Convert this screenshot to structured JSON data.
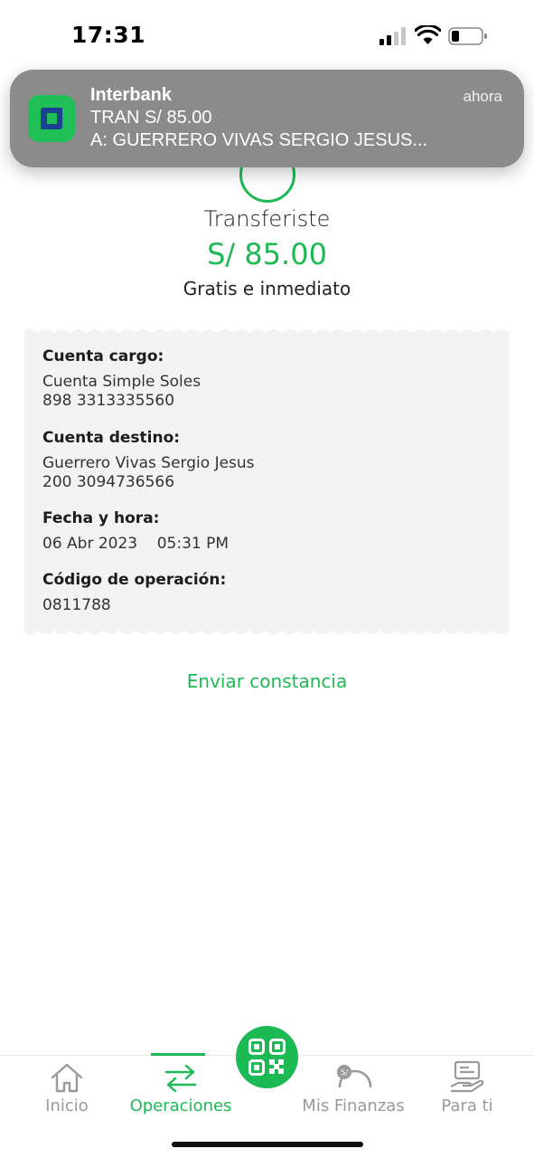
{
  "status_bar": {
    "time": "17:31"
  },
  "notification": {
    "app_name": "Interbank",
    "time": "ahora",
    "line1": "TRAN S/ 85.00",
    "line2": "A: GUERRERO VIVAS SERGIO JESUS..."
  },
  "header": {
    "title": "Transferiste",
    "amount": "S/ 85.00",
    "subtitle": "Gratis e inmediato"
  },
  "receipt": {
    "cuenta_cargo": {
      "label": "Cuenta cargo:",
      "name": "Cuenta Simple Soles",
      "number": "898 3313335560"
    },
    "cuenta_destino": {
      "label": "Cuenta destino:",
      "name": "Guerrero Vivas Sergio Jesus",
      "number": "200 3094736566"
    },
    "fecha": {
      "label": "Fecha y hora:",
      "value": "06 Abr 2023    05:31 PM"
    },
    "codigo": {
      "label": "Código de operación:",
      "value": "0811788"
    }
  },
  "actions": {
    "send_receipt": "Enviar constancia"
  },
  "bottom_nav": {
    "items": [
      {
        "label": "Inicio",
        "icon": "home-icon"
      },
      {
        "label": "Operaciones",
        "icon": "transfer-arrows-icon",
        "active": true
      },
      {
        "label": "Mis Finanzas",
        "icon": "gauge-icon"
      },
      {
        "label": "Para ti",
        "icon": "card-hand-icon"
      }
    ],
    "center_icon": "qr-code-icon"
  },
  "colors": {
    "accent": "#1db954",
    "notification_bg": "#8b8b8b",
    "receipt_bg": "#f3f3f3",
    "brand_inner": "#1b3f91"
  }
}
